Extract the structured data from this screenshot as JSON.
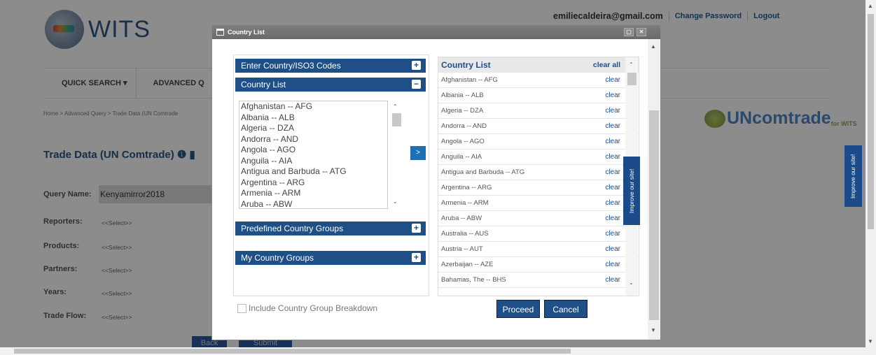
{
  "site": {
    "logo_text": "WITS"
  },
  "userbar": {
    "email": "emiliecaldeira@gmail.com",
    "change_password": "Change Password",
    "logout": "Logout"
  },
  "nav": {
    "quick_search": "QUICK SEARCH ▾",
    "advanced_query": "ADVANCED Q"
  },
  "breadcrumb": "Home > Advanced Query > Trade Data (UN Comtrade",
  "page_title": "Trade Data (UN Comtrade) ❶ ▮",
  "query": {
    "name_label": "Query Name:",
    "name_value": "Kenyamirror2018"
  },
  "fields": [
    {
      "label": "Reporters:",
      "value": "<<Select>>"
    },
    {
      "label": "Products:",
      "value": "<<Select>>"
    },
    {
      "label": "Partners:",
      "value": "<<Select>>"
    },
    {
      "label": "Years:",
      "value": "<<Select>>"
    },
    {
      "label": "Trade Flow:",
      "value": "<<Select>>"
    }
  ],
  "bg_buttons": {
    "back": "Back",
    "submit": "Submit"
  },
  "uncomtrade": {
    "text": "UNcomtrade",
    "sub": "for WITS"
  },
  "improve": "Improve our site!",
  "modal": {
    "title": "Country List",
    "sections": {
      "enter_codes": "Enter Country/ISO3 Codes",
      "country_list": "Country List",
      "predefined_groups": "Predefined Country Groups",
      "my_groups": "My Country Groups"
    },
    "available": [
      "Afghanistan -- AFG",
      "Albania -- ALB",
      "Algeria -- DZA",
      "Andorra -- AND",
      "Angola -- AGO",
      "Anguila -- AIA",
      "Antigua and Barbuda -- ATG",
      "Argentina -- ARG",
      "Armenia -- ARM",
      "Aruba -- ABW"
    ],
    "move_button": ">",
    "selected_header": "Country List",
    "clear_all": "clear all",
    "clear": "clear",
    "selected": [
      "Afghanistan -- AFG",
      "Albania -- ALB",
      "Algeria -- DZA",
      "Andorra -- AND",
      "Angola -- AGO",
      "Anguila -- AIA",
      "Antigua and Barbuda -- ATG",
      "Argentina -- ARG",
      "Armenia -- ARM",
      "Aruba -- ABW",
      "Australia -- AUS",
      "Austria -- AUT",
      "Azerbaijan -- AZE",
      "Bahamas, The -- BHS"
    ],
    "include_breakdown": "Include Country Group Breakdown",
    "proceed": "Proceed",
    "cancel": "Cancel"
  }
}
